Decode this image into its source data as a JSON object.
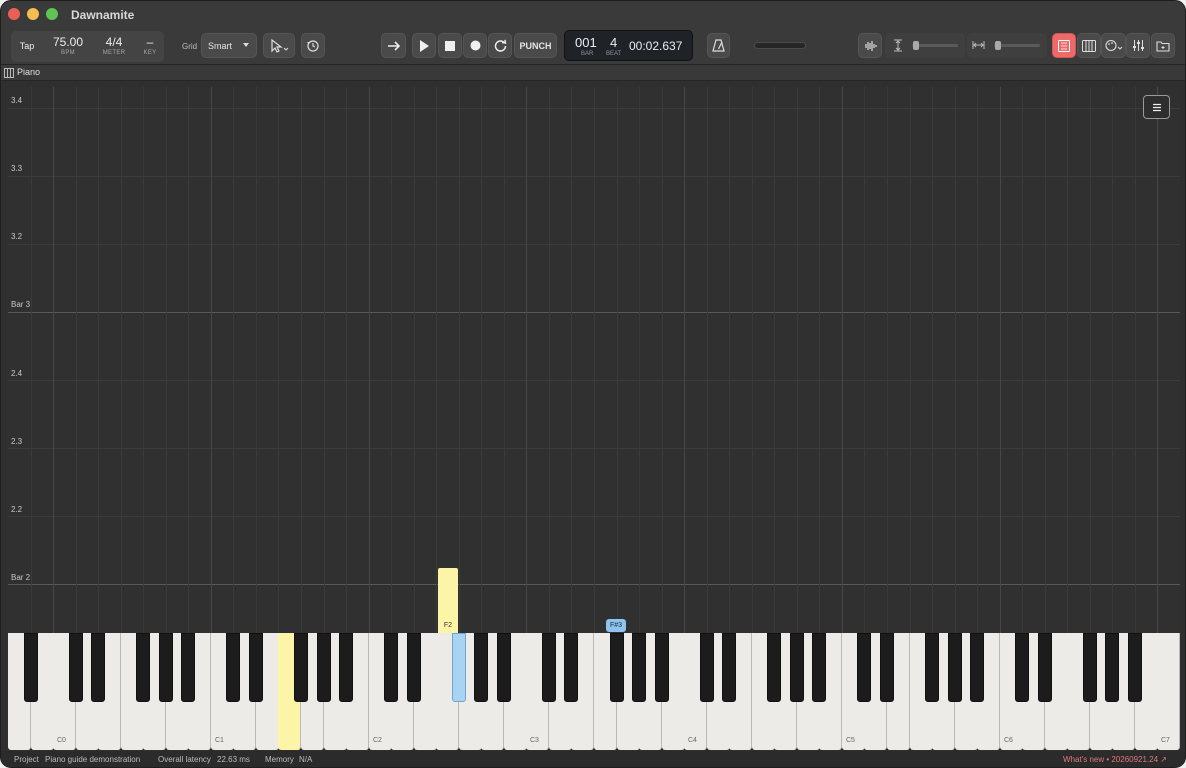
{
  "app": {
    "title": "Dawnamite"
  },
  "toolbar": {
    "tap_label": "Tap",
    "bpm_value": "75.00",
    "bpm_label": "BPM",
    "meter_value": "4/4",
    "meter_label": "METER",
    "key_value": "–",
    "key_label": "KEY",
    "grid_label": "Grid",
    "grid_value": "Smart",
    "punch_label": "PUNCH",
    "position": {
      "bar": "001",
      "bar_label": "BAR",
      "beat": "4",
      "beat_label": "BEAT",
      "time": "00:02.637"
    }
  },
  "track": {
    "name": "Piano"
  },
  "roll": {
    "rows": [
      "3.4",
      "3.3",
      "3.2",
      "Bar 3",
      "2.4",
      "2.3",
      "2.2",
      "Bar 2"
    ]
  },
  "notes": {
    "active_white": "F2",
    "active_black": "F#3"
  },
  "keyboard": {
    "octave_labels": [
      "C0",
      "C1",
      "C2",
      "C3",
      "C4",
      "C5",
      "C6",
      "C7"
    ]
  },
  "status": {
    "project_label": "Project",
    "project_name": "Piano guide demonstration",
    "latency_label": "Overall latency",
    "latency_value": "22.63 ms",
    "memory_label": "Memory",
    "memory_value": "N/A",
    "whats_new": "What's new • 20260921.24 ↗"
  },
  "colors": {
    "active_white_key": "#fcf4a6",
    "active_black_key": "#a9d3f3",
    "piano_roll_button_active": "#ec6a6a"
  }
}
